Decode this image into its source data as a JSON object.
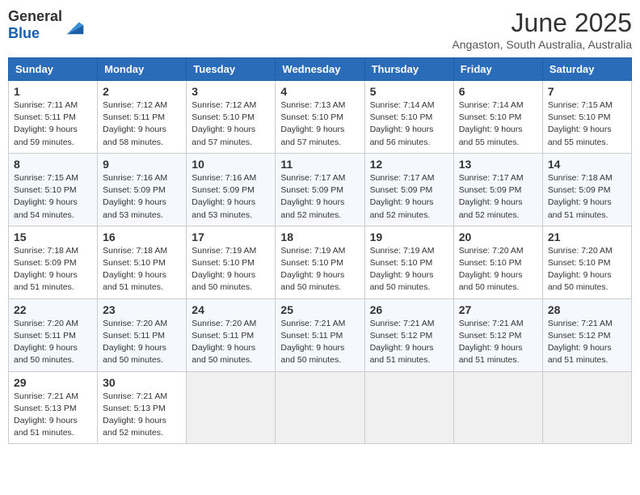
{
  "header": {
    "logo_general": "General",
    "logo_blue": "Blue",
    "month_title": "June 2025",
    "location": "Angaston, South Australia, Australia"
  },
  "weekdays": [
    "Sunday",
    "Monday",
    "Tuesday",
    "Wednesday",
    "Thursday",
    "Friday",
    "Saturday"
  ],
  "weeks": [
    [
      {
        "day": "1",
        "sunrise": "7:11 AM",
        "sunset": "5:11 PM",
        "daylight": "9 hours and 59 minutes."
      },
      {
        "day": "2",
        "sunrise": "7:12 AM",
        "sunset": "5:11 PM",
        "daylight": "9 hours and 58 minutes."
      },
      {
        "day": "3",
        "sunrise": "7:12 AM",
        "sunset": "5:10 PM",
        "daylight": "9 hours and 57 minutes."
      },
      {
        "day": "4",
        "sunrise": "7:13 AM",
        "sunset": "5:10 PM",
        "daylight": "9 hours and 57 minutes."
      },
      {
        "day": "5",
        "sunrise": "7:14 AM",
        "sunset": "5:10 PM",
        "daylight": "9 hours and 56 minutes."
      },
      {
        "day": "6",
        "sunrise": "7:14 AM",
        "sunset": "5:10 PM",
        "daylight": "9 hours and 55 minutes."
      },
      {
        "day": "7",
        "sunrise": "7:15 AM",
        "sunset": "5:10 PM",
        "daylight": "9 hours and 55 minutes."
      }
    ],
    [
      {
        "day": "8",
        "sunrise": "7:15 AM",
        "sunset": "5:10 PM",
        "daylight": "9 hours and 54 minutes."
      },
      {
        "day": "9",
        "sunrise": "7:16 AM",
        "sunset": "5:09 PM",
        "daylight": "9 hours and 53 minutes."
      },
      {
        "day": "10",
        "sunrise": "7:16 AM",
        "sunset": "5:09 PM",
        "daylight": "9 hours and 53 minutes."
      },
      {
        "day": "11",
        "sunrise": "7:17 AM",
        "sunset": "5:09 PM",
        "daylight": "9 hours and 52 minutes."
      },
      {
        "day": "12",
        "sunrise": "7:17 AM",
        "sunset": "5:09 PM",
        "daylight": "9 hours and 52 minutes."
      },
      {
        "day": "13",
        "sunrise": "7:17 AM",
        "sunset": "5:09 PM",
        "daylight": "9 hours and 52 minutes."
      },
      {
        "day": "14",
        "sunrise": "7:18 AM",
        "sunset": "5:09 PM",
        "daylight": "9 hours and 51 minutes."
      }
    ],
    [
      {
        "day": "15",
        "sunrise": "7:18 AM",
        "sunset": "5:09 PM",
        "daylight": "9 hours and 51 minutes."
      },
      {
        "day": "16",
        "sunrise": "7:18 AM",
        "sunset": "5:10 PM",
        "daylight": "9 hours and 51 minutes."
      },
      {
        "day": "17",
        "sunrise": "7:19 AM",
        "sunset": "5:10 PM",
        "daylight": "9 hours and 50 minutes."
      },
      {
        "day": "18",
        "sunrise": "7:19 AM",
        "sunset": "5:10 PM",
        "daylight": "9 hours and 50 minutes."
      },
      {
        "day": "19",
        "sunrise": "7:19 AM",
        "sunset": "5:10 PM",
        "daylight": "9 hours and 50 minutes."
      },
      {
        "day": "20",
        "sunrise": "7:20 AM",
        "sunset": "5:10 PM",
        "daylight": "9 hours and 50 minutes."
      },
      {
        "day": "21",
        "sunrise": "7:20 AM",
        "sunset": "5:10 PM",
        "daylight": "9 hours and 50 minutes."
      }
    ],
    [
      {
        "day": "22",
        "sunrise": "7:20 AM",
        "sunset": "5:11 PM",
        "daylight": "9 hours and 50 minutes."
      },
      {
        "day": "23",
        "sunrise": "7:20 AM",
        "sunset": "5:11 PM",
        "daylight": "9 hours and 50 minutes."
      },
      {
        "day": "24",
        "sunrise": "7:20 AM",
        "sunset": "5:11 PM",
        "daylight": "9 hours and 50 minutes."
      },
      {
        "day": "25",
        "sunrise": "7:21 AM",
        "sunset": "5:11 PM",
        "daylight": "9 hours and 50 minutes."
      },
      {
        "day": "26",
        "sunrise": "7:21 AM",
        "sunset": "5:12 PM",
        "daylight": "9 hours and 51 minutes."
      },
      {
        "day": "27",
        "sunrise": "7:21 AM",
        "sunset": "5:12 PM",
        "daylight": "9 hours and 51 minutes."
      },
      {
        "day": "28",
        "sunrise": "7:21 AM",
        "sunset": "5:12 PM",
        "daylight": "9 hours and 51 minutes."
      }
    ],
    [
      {
        "day": "29",
        "sunrise": "7:21 AM",
        "sunset": "5:13 PM",
        "daylight": "9 hours and 51 minutes."
      },
      {
        "day": "30",
        "sunrise": "7:21 AM",
        "sunset": "5:13 PM",
        "daylight": "9 hours and 52 minutes."
      },
      null,
      null,
      null,
      null,
      null
    ]
  ]
}
